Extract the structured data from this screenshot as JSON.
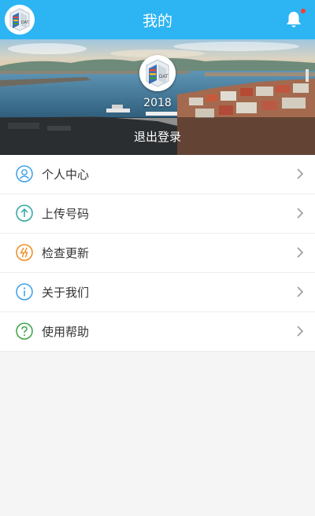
{
  "header": {
    "title": "我的",
    "avatar_icon": "app-logo-icon",
    "bell_icon": "bell-icon",
    "has_notification": true
  },
  "profile": {
    "name": "2018",
    "avatar_icon": "app-logo-icon",
    "logout_label": "退出登录"
  },
  "menu": {
    "items": [
      {
        "label": "个人中心",
        "icon": "user-icon",
        "color": "#3aa0e8"
      },
      {
        "label": "上传号码",
        "icon": "upload-icon",
        "color": "#2aa7a0"
      },
      {
        "label": "检查更新",
        "icon": "update-icon",
        "color": "#f08c1c"
      },
      {
        "label": "关于我们",
        "icon": "info-icon",
        "color": "#3aa0e8"
      },
      {
        "label": "使用帮助",
        "icon": "help-icon",
        "color": "#3aa346"
      }
    ]
  },
  "colors": {
    "header_bg": "#2db4f3",
    "page_bg": "#f5f5f5"
  }
}
